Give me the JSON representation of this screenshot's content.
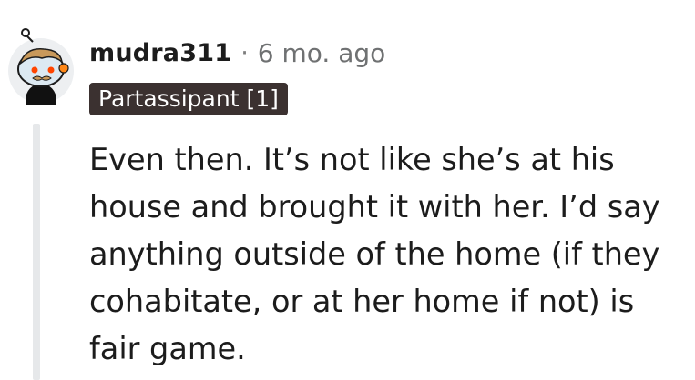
{
  "comment": {
    "username": "mudra311",
    "separator": "·",
    "timestamp": "6 mo. ago",
    "flair": "Partassipant [1]",
    "body": "Even then. It’s not like she’s at his house and brought it with her. I’d say anything outside of the home (if they cohabitate, or at her home if not) is fair game."
  },
  "avatar": {
    "icon": "reddit-snoo-avatar-icon"
  },
  "colors": {
    "flair_background": "#3b3130",
    "flair_text": "#ffffff",
    "username": "#1c1c1c",
    "meta": "#6f7172",
    "thread_line": "#e6e8ea"
  }
}
